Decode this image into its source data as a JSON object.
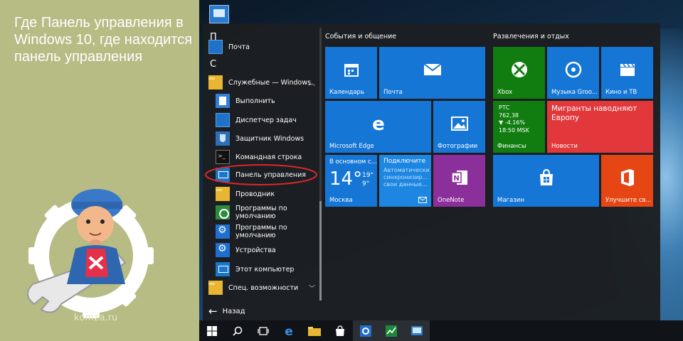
{
  "banner": {
    "title": "Где Панель управления в Windows 10, где находится панель управления",
    "site": "komza.ru"
  },
  "app_list": {
    "letters": [
      "П",
      "С"
    ],
    "items": [
      {
        "label": "Почта",
        "icon": "mail-icon"
      },
      {
        "label": "Служебные — Windows",
        "icon": "folder-icon"
      },
      {
        "label": "Выполнить",
        "icon": "run-icon"
      },
      {
        "label": "Диспетчер задач",
        "icon": "task-manager-icon"
      },
      {
        "label": "Защитник Windows",
        "icon": "shield-icon"
      },
      {
        "label": "Командная строка",
        "icon": "cmd-icon"
      },
      {
        "label": "Панель управления",
        "icon": "control-panel-icon"
      },
      {
        "label": "Проводник",
        "icon": "explorer-folder-icon"
      },
      {
        "label": "Программы по умолчанию",
        "icon": "default-programs-icon"
      },
      {
        "label": "Программы по умолчанию",
        "icon": "gear-icon"
      },
      {
        "label": "Устройства",
        "icon": "gear-icon"
      },
      {
        "label": "Этот компьютер",
        "icon": "computer-icon"
      },
      {
        "label": "Спец. возможности",
        "icon": "folder-icon"
      }
    ],
    "back_label": "Назад"
  },
  "groups": {
    "left": "События и общение",
    "right": "Развлечения и отдых"
  },
  "tiles": {
    "calendar": "Календарь",
    "mail": "Почта",
    "xbox": "Xbox",
    "groove": "Музыка Groo...",
    "movies": "Кино и ТВ",
    "edge": "Microsoft Edge",
    "photos": "Фотографии",
    "finance": {
      "label": "Финансы",
      "lines": [
        "РТС",
        "762,38",
        "▼ -4.16%",
        "18:50 MSK"
      ]
    },
    "news": {
      "label": "Новости",
      "headline": "Мигранты наводняют Европу"
    },
    "weather": {
      "condition": "В основном с...",
      "temp": "14°",
      "high": "19°",
      "low": "9°",
      "city": "Москва"
    },
    "mail_live": {
      "title": "Подключите",
      "body": "Автоматически синхронизир... свои данные..."
    },
    "onenote": "OneNote",
    "store": "Магазин",
    "office": "Улучшите св..."
  },
  "taskbar": {
    "items": [
      "windows-start-icon",
      "search-icon",
      "task-view-icon",
      "edge-icon",
      "file-explorer-icon",
      "store-icon",
      "settings-icon",
      "task-manager-icon",
      "control-panel-icon"
    ]
  },
  "colors": {
    "banner": "#b7bb84",
    "start_bg": "#1c1e21",
    "tile_blue": "#1576d6",
    "tile_green": "#117d10",
    "tile_red": "#e2383b",
    "highlight_ring": "#d8282a"
  }
}
